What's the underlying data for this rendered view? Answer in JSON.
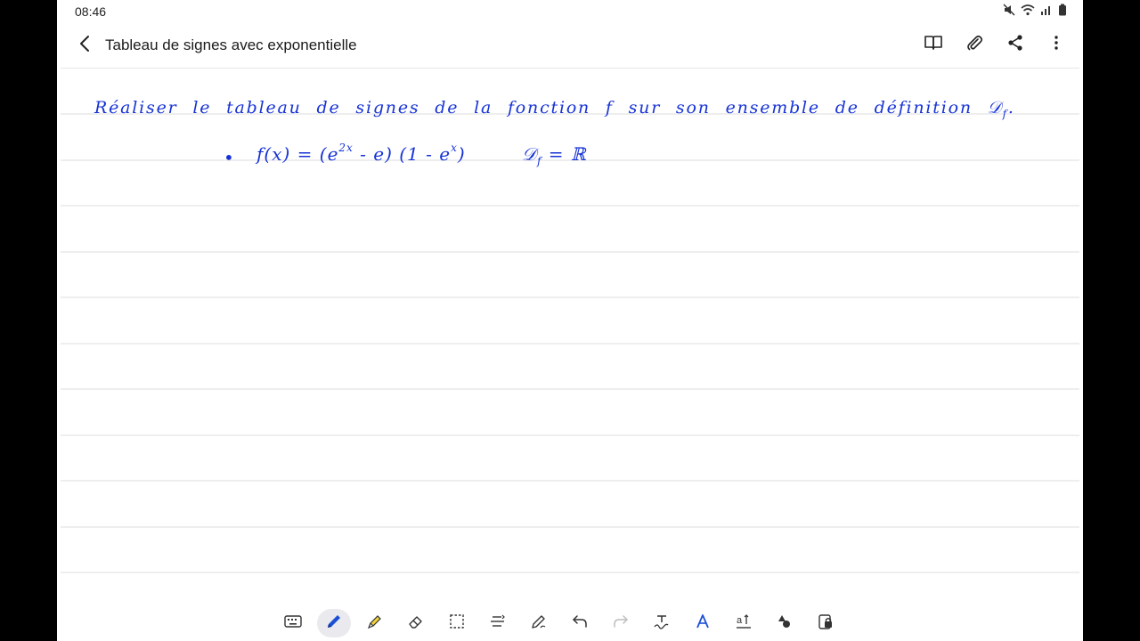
{
  "status_bar": {
    "time": "08:46",
    "icons": [
      "mute-icon",
      "wifi-icon",
      "signal-icon",
      "battery-icon"
    ]
  },
  "app_bar": {
    "title": "Tableau de signes avec exponentielle",
    "actions": [
      "book-icon",
      "attachment-icon",
      "share-icon",
      "more-vert-icon"
    ]
  },
  "note": {
    "instruction": "Réaliser le tableau de signes de la fonction f sur son ensemble de définition",
    "instruction_symbol": "𝒟",
    "instruction_sub": "f",
    "instruction_end": ".",
    "bullet": "•",
    "formula_lhs": "f(x) = (e",
    "formula_exp1": "2x",
    "formula_mid": " - e)  (1 - e",
    "formula_exp2": "x",
    "formula_end": ")",
    "domain_symbol": "𝒟",
    "domain_sub": "f",
    "domain_rhs": " = ℝ"
  },
  "toolbar": {
    "tools": [
      "keyboard-icon",
      "pen-icon",
      "highlighter-icon",
      "eraser-icon",
      "lasso-select-icon",
      "text-align-icon",
      "edit-pen-icon",
      "undo-icon",
      "redo-icon",
      "handwriting-text-icon",
      "text-style-icon",
      "text-spacing-icon",
      "shapes-icon",
      "lock-icon"
    ],
    "active_tool": "pen-icon"
  },
  "colors": {
    "ink": "#1733d6",
    "line": "#dcdcdc",
    "active_tool_bg": "#e9e9ee"
  }
}
